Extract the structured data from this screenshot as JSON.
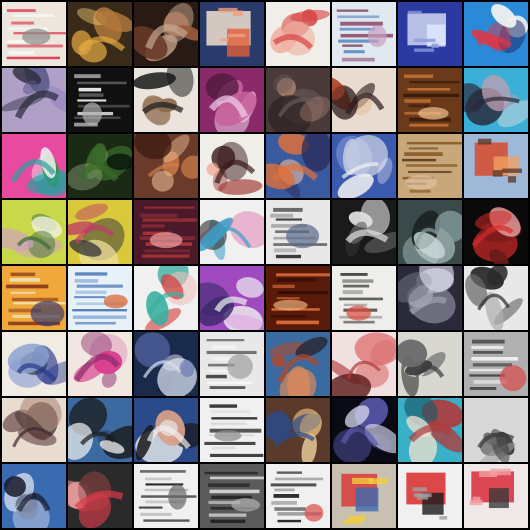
{
  "grid": {
    "rows": 8,
    "cols": 8,
    "background": "#000000",
    "tiles": [
      {
        "bg": "#ece6dc",
        "accents": [
          "#d8344a",
          "#8a8a8a",
          "#fafafa"
        ],
        "style": "text"
      },
      {
        "bg": "#3a2a1a",
        "accents": [
          "#e0a640",
          "#b0783a",
          "#f0d070"
        ],
        "style": "blob"
      },
      {
        "bg": "#2a1a14",
        "accents": [
          "#c8a890",
          "#9a5a3a",
          "#6a3a28"
        ],
        "style": "blob"
      },
      {
        "bg": "#2a3a6a",
        "accents": [
          "#f0e0d0",
          "#e0603a",
          "#f0a080"
        ],
        "style": "poster"
      },
      {
        "bg": "#f0eee8",
        "accents": [
          "#d84040",
          "#f0b0a0",
          "#e06a6a"
        ],
        "style": "blob"
      },
      {
        "bg": "#e0e8f0",
        "accents": [
          "#8a4a6a",
          "#c8a0c0",
          "#5a8ac0"
        ],
        "style": "text"
      },
      {
        "bg": "#2a3aa0",
        "accents": [
          "#d0d8f0",
          "#e0e8ff",
          "#8a9ad8"
        ],
        "style": "poster"
      },
      {
        "bg": "#2a8ad8",
        "accents": [
          "#d83a4a",
          "#f0f0f0",
          "#1a2a6a"
        ],
        "style": "blob"
      },
      {
        "bg": "#b0a0c8",
        "accents": [
          "#2a2a3a",
          "#5a5a8a",
          "#8a78b8"
        ],
        "style": "blob"
      },
      {
        "bg": "#101010",
        "accents": [
          "#f0f0f0",
          "#b0b0b0",
          "#6a6a6a"
        ],
        "style": "text"
      },
      {
        "bg": "#eae4dc",
        "accents": [
          "#1a1a1a",
          "#8a6a4a",
          "#c8b090"
        ],
        "style": "blob"
      },
      {
        "bg": "#8a2a6a",
        "accents": [
          "#f0d0e8",
          "#c8609a",
          "#4a1a3a"
        ],
        "style": "blob"
      },
      {
        "bg": "#4a3a3a",
        "accents": [
          "#6a5a5a",
          "#a07a6a",
          "#2a2020"
        ],
        "style": "blob"
      },
      {
        "bg": "#e8dcd0",
        "accents": [
          "#2a1a1a",
          "#b04a2a",
          "#e8c0a0"
        ],
        "style": "blob"
      },
      {
        "bg": "#6a3a1a",
        "accents": [
          "#d8803a",
          "#f0c090",
          "#3a1a0a"
        ],
        "style": "text"
      },
      {
        "bg": "#3ab0d8",
        "accents": [
          "#2a2a3a",
          "#c0a0b0",
          "#f0e0e0"
        ],
        "style": "blob"
      },
      {
        "bg": "#e84aa0",
        "accents": [
          "#2aa0a0",
          "#f0f0f0",
          "#3a8a3a"
        ],
        "style": "blob"
      },
      {
        "bg": "#1a2a14",
        "accents": [
          "#3a6a2a",
          "#8aa07a",
          "#0a140a"
        ],
        "style": "blob"
      },
      {
        "bg": "#6a3a2a",
        "accents": [
          "#d0804a",
          "#f0c09a",
          "#3a1a10"
        ],
        "style": "blob"
      },
      {
        "bg": "#f0eee8",
        "accents": [
          "#3a1a1a",
          "#a03a3a",
          "#f0a08a"
        ],
        "style": "blob"
      },
      {
        "bg": "#3a5aa0",
        "accents": [
          "#e0703a",
          "#2a2a5a",
          "#f0c0a0"
        ],
        "style": "blob"
      },
      {
        "bg": "#3a5ab0",
        "accents": [
          "#f0f0f0",
          "#c0c8e0",
          "#8aa0d8"
        ],
        "style": "blob"
      },
      {
        "bg": "#c8a87a",
        "accents": [
          "#8a5a2a",
          "#e0c0a0",
          "#5a3a1a"
        ],
        "style": "text"
      },
      {
        "bg": "#a0b8d8",
        "accents": [
          "#d84a2a",
          "#f0a060",
          "#5a3a2a"
        ],
        "style": "poster"
      },
      {
        "bg": "#c8d84a",
        "accents": [
          "#3a6a3a",
          "#d0a0c0",
          "#f0f0e0"
        ],
        "style": "blob"
      },
      {
        "bg": "#d8c83a",
        "accents": [
          "#c03a6a",
          "#3a3a3a",
          "#f0e0a0"
        ],
        "style": "blob"
      },
      {
        "bg": "#4a1a2a",
        "accents": [
          "#c03a3a",
          "#f0a0a0",
          "#8a2a3a"
        ],
        "style": "text"
      },
      {
        "bg": "#f0f0f0",
        "accents": [
          "#3aa0c8",
          "#e07ab0",
          "#2a2a2a"
        ],
        "style": "blob"
      },
      {
        "bg": "#e8e8e8",
        "accents": [
          "#2a2a2a",
          "#5a6a8a",
          "#a0a0a0"
        ],
        "style": "text"
      },
      {
        "bg": "#1a1a1a",
        "accents": [
          "#e0e0e0",
          "#6a6a6a",
          "#2a2a2a"
        ],
        "style": "blob"
      },
      {
        "bg": "#3a4a4a",
        "accents": [
          "#8aa0a0",
          "#c8d8d8",
          "#1a2020"
        ],
        "style": "blob"
      },
      {
        "bg": "#0a0a0a",
        "accents": [
          "#d82a2a",
          "#6a1a1a",
          "#f0a0a0"
        ],
        "style": "blob"
      },
      {
        "bg": "#f0a83a",
        "accents": [
          "#8a3a1a",
          "#3a3a6a",
          "#f0e0b0"
        ],
        "style": "text"
      },
      {
        "bg": "#e8f0f8",
        "accents": [
          "#3a6ab0",
          "#d8602a",
          "#8ab0d8"
        ],
        "style": "text"
      },
      {
        "bg": "#f0f0f0",
        "accents": [
          "#3ab0a0",
          "#d83a3a",
          "#f0c0c0"
        ],
        "style": "blob"
      },
      {
        "bg": "#a04ac0",
        "accents": [
          "#f0f0f0",
          "#3a2a6a",
          "#e0a0e0"
        ],
        "style": "blob"
      },
      {
        "bg": "#5a1a0a",
        "accents": [
          "#e0703a",
          "#f0b07a",
          "#2a0a04"
        ],
        "style": "text"
      },
      {
        "bg": "#f0eeea",
        "accents": [
          "#3a3a3a",
          "#d84a3a",
          "#8a8a8a"
        ],
        "style": "text"
      },
      {
        "bg": "#2a2a3a",
        "accents": [
          "#a0a0b0",
          "#e0e0f0",
          "#5a5a6a"
        ],
        "style": "blob"
      },
      {
        "bg": "#e8e8e8",
        "accents": [
          "#2a2a2a",
          "#6a6a6a",
          "#b0b0b0"
        ],
        "style": "blob"
      },
      {
        "bg": "#f0ece4",
        "accents": [
          "#2a3a8a",
          "#8aa0d0",
          "#3a3a3a"
        ],
        "style": "blob"
      },
      {
        "bg": "#f0e8e0",
        "accents": [
          "#8a2a6a",
          "#d83a8a",
          "#e0a0c0"
        ],
        "style": "blob"
      },
      {
        "bg": "#1a2a4a",
        "accents": [
          "#d8e0f0",
          "#5a6ab0",
          "#0a1020"
        ],
        "style": "blob"
      },
      {
        "bg": "#e8e8e8",
        "accents": [
          "#3a3a3a",
          "#a0a0a0",
          "#f8f8f8"
        ],
        "style": "text"
      },
      {
        "bg": "#3a6aa0",
        "accents": [
          "#b04a2a",
          "#e08a5a",
          "#2a2a3a"
        ],
        "style": "blob"
      },
      {
        "bg": "#f0e0e0",
        "accents": [
          "#b03a3a",
          "#e07a7a",
          "#5a1a1a"
        ],
        "style": "blob"
      },
      {
        "bg": "#d8d8d0",
        "accents": [
          "#3a3a3a",
          "#6a6a6a",
          "#f0f0f0"
        ],
        "style": "blob"
      },
      {
        "bg": "#b0b0b0",
        "accents": [
          "#3a3a3a",
          "#d84a4a",
          "#f0f0f0"
        ],
        "style": "text"
      },
      {
        "bg": "#e8dcd0",
        "accents": [
          "#3a2a2a",
          "#6a4a4a",
          "#b08a7a"
        ],
        "style": "blob"
      },
      {
        "bg": "#3a6aa0",
        "accents": [
          "#1a1a1a",
          "#f0f0f0",
          "#2a3a5a"
        ],
        "style": "blob"
      },
      {
        "bg": "#2a4a8a",
        "accents": [
          "#f0f0f0",
          "#1a1a1a",
          "#d8a08a"
        ],
        "style": "blob"
      },
      {
        "bg": "#f0f0f0",
        "accents": [
          "#1a1a1a",
          "#8a8a8a",
          "#d8d8d8"
        ],
        "style": "text"
      },
      {
        "bg": "#5a3a2a",
        "accents": [
          "#2a4a8a",
          "#d8b07a",
          "#f0d0a0"
        ],
        "style": "blob"
      },
      {
        "bg": "#0a0a14",
        "accents": [
          "#5a5ab0",
          "#d8d8f0",
          "#2a2a4a"
        ],
        "style": "blob"
      },
      {
        "bg": "#3ab0c8",
        "accents": [
          "#b03a3a",
          "#f0e0d0",
          "#1a5a6a"
        ],
        "style": "blob"
      },
      {
        "bg": "#d8d8d8",
        "accents": [
          "#3a3a3a",
          "#6a6a6a",
          "#a0a0a0"
        ],
        "style": "blob"
      },
      {
        "bg": "#3a6ab0",
        "accents": [
          "#1a1a2a",
          "#d8e0f0",
          "#2a3a5a"
        ],
        "style": "blob"
      },
      {
        "bg": "#2a2a2a",
        "accents": [
          "#d83a4a",
          "#f0a0a0",
          "#6a3a3a"
        ],
        "style": "blob"
      },
      {
        "bg": "#f0f0f0",
        "accents": [
          "#1a1a1a",
          "#6a6a6a",
          "#b0b0b0"
        ],
        "style": "text"
      },
      {
        "bg": "#5a5a5a",
        "accents": [
          "#1a1a1a",
          "#b0b0b0",
          "#e0e0e0"
        ],
        "style": "text"
      },
      {
        "bg": "#f0f0f0",
        "accents": [
          "#1a1a1a",
          "#d84a4a",
          "#8a8a8a"
        ],
        "style": "text"
      },
      {
        "bg": "#c8c0b0",
        "accents": [
          "#d83a3a",
          "#3a6ab0",
          "#f0d03a"
        ],
        "style": "poster"
      },
      {
        "bg": "#f0f0f0",
        "accents": [
          "#d82a2a",
          "#1a1a1a",
          "#a0a0a0"
        ],
        "style": "poster"
      },
      {
        "bg": "#f0e8e8",
        "accents": [
          "#d82a3a",
          "#3a3a3a",
          "#f0a0a0"
        ],
        "style": "poster"
      }
    ]
  }
}
